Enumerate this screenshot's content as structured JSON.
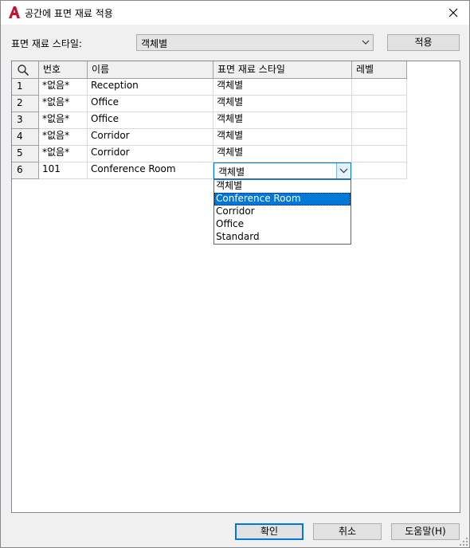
{
  "window": {
    "title": "공간에 표면 재료 적용"
  },
  "style_label": "표면 재료 스타일:",
  "style_combo": {
    "value": "객체별"
  },
  "apply_button": "적용",
  "grid": {
    "columns": [
      "번호",
      "이름",
      "표면 재료 스타일",
      "레벨"
    ],
    "rows": [
      {
        "index": "1",
        "number": "*없음*",
        "name": "Reception",
        "style": "객체별",
        "level": ""
      },
      {
        "index": "2",
        "number": "*없음*",
        "name": "Office",
        "style": "객체별",
        "level": ""
      },
      {
        "index": "3",
        "number": "*없음*",
        "name": "Office",
        "style": "객체별",
        "level": ""
      },
      {
        "index": "4",
        "number": "*없음*",
        "name": "Corridor",
        "style": "객체별",
        "level": ""
      },
      {
        "index": "5",
        "number": "*없음*",
        "name": "Corridor",
        "style": "객체별",
        "level": ""
      },
      {
        "index": "6",
        "number": "101",
        "name": "Conference Room",
        "style": "객체별",
        "level": ""
      }
    ]
  },
  "dropdown": {
    "options": [
      "객체별",
      "Conference Room",
      "Corridor",
      "Office",
      "Standard"
    ],
    "selected": "Conference Room"
  },
  "buttons": {
    "ok": "확인",
    "cancel": "취소",
    "help": "도움말(H)"
  },
  "colors": {
    "accent": "#0078d7",
    "app_icon": "#c8102e"
  }
}
